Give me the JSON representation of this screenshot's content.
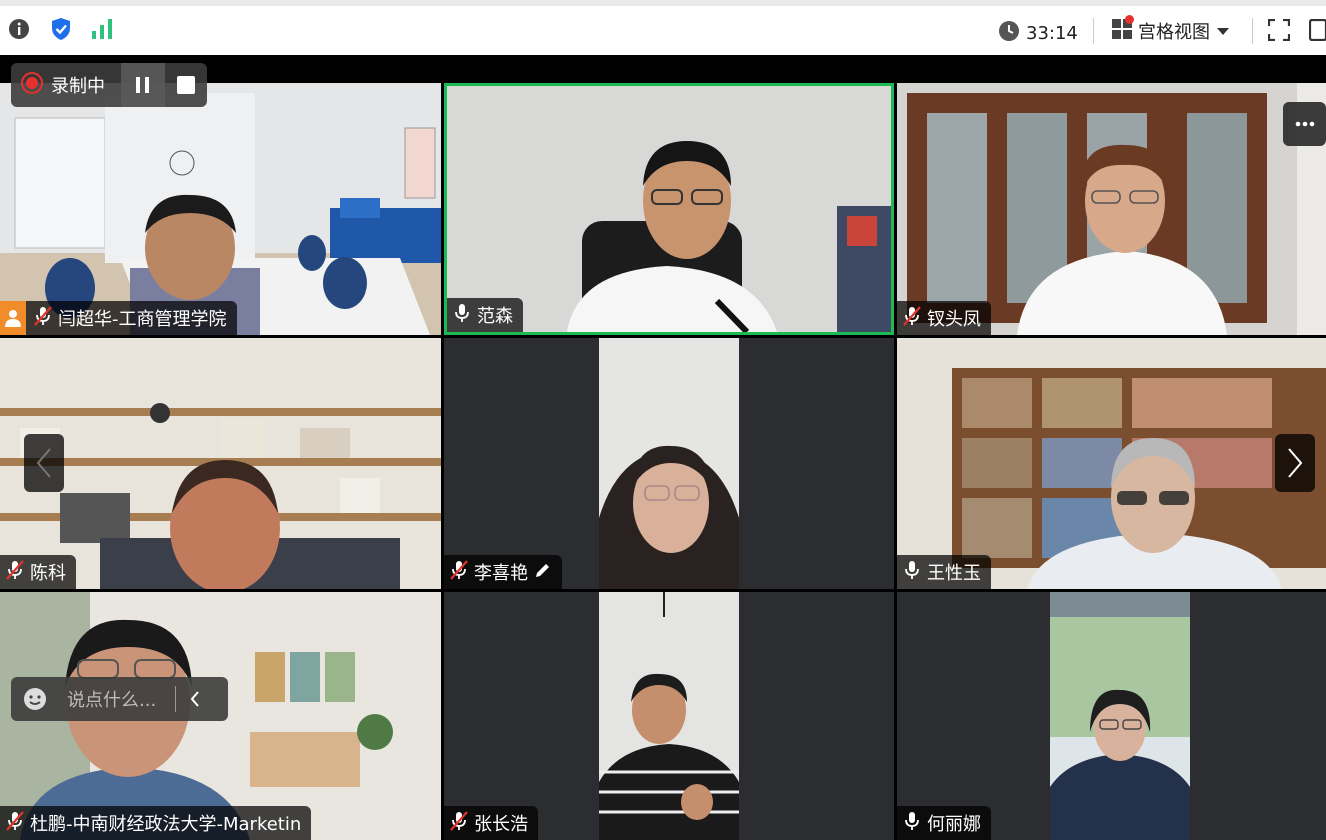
{
  "topbar": {
    "info_icon": "info-icon",
    "shield_icon": "shield-check-icon",
    "signal_icon": "signal-icon",
    "timer": "33:14",
    "layout_label": "宫格视图"
  },
  "recording": {
    "status": "录制中"
  },
  "chat": {
    "placeholder": "说点什么..."
  },
  "participants": [
    {
      "name": "闫超华-工商管理学院",
      "mic": "muted"
    },
    {
      "name": "范森",
      "mic": "on"
    },
    {
      "name": "钗头凤",
      "mic": "muted"
    },
    {
      "name": "陈科",
      "mic": "muted"
    },
    {
      "name": "李喜艳",
      "mic": "muted"
    },
    {
      "name": "王性玉",
      "mic": "on"
    },
    {
      "name": "杜鹏-中南财经政法大学-Marketin",
      "mic": "muted"
    },
    {
      "name": "张长浩",
      "mic": "muted"
    },
    {
      "name": "何丽娜",
      "mic": "on"
    }
  ],
  "colors": {
    "active_speaker_border": "#1db954",
    "accent_blue": "#1f6feb",
    "record_red": "#e5322d"
  }
}
